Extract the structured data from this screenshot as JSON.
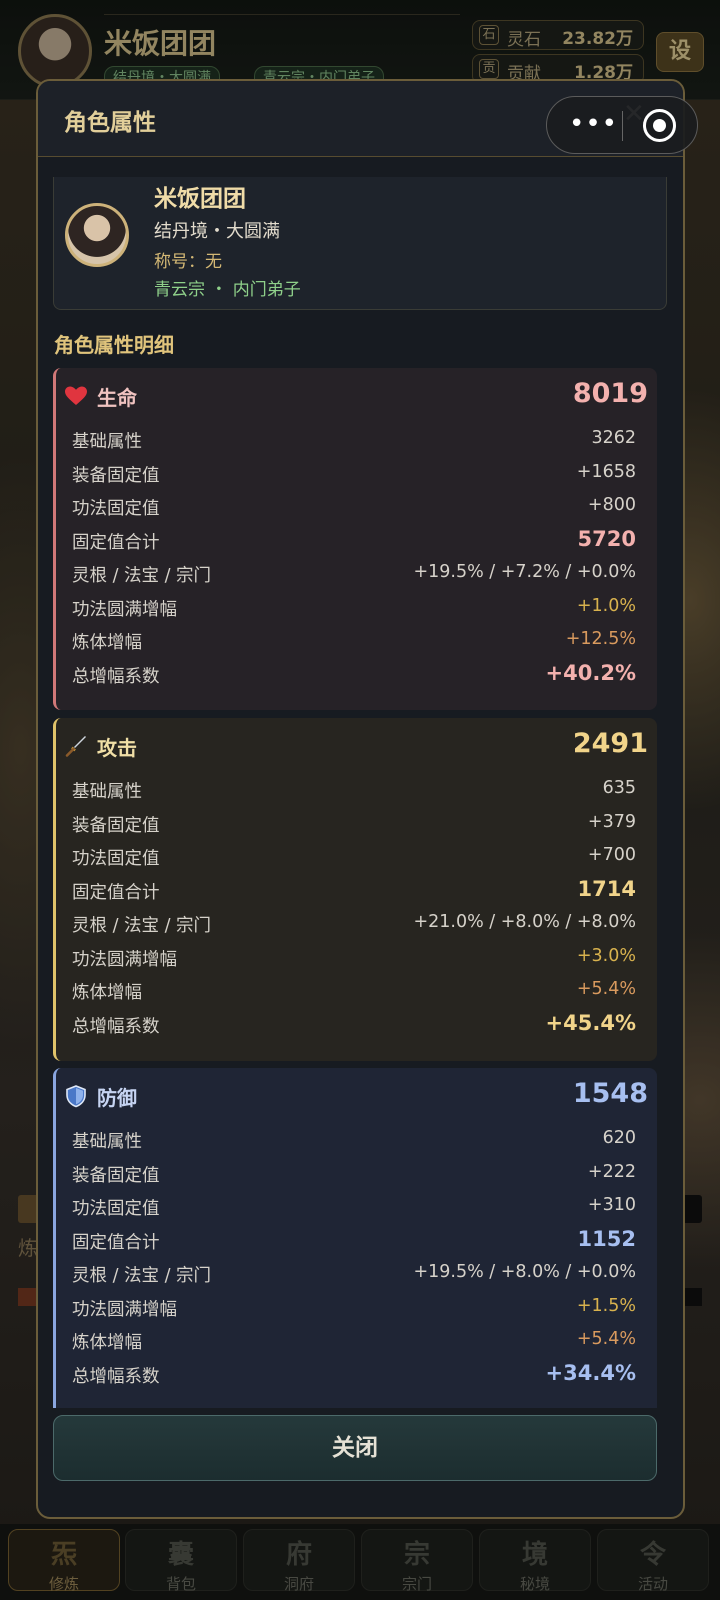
{
  "header": {
    "player_name": "米饭团团",
    "tag_realm": "结丹境・大圆满",
    "tag_sect": "青云宗・内门弟子",
    "resources": [
      {
        "icon_text": "石",
        "label": "灵石",
        "value": "23.82万"
      },
      {
        "icon_text": "贡",
        "label": "贡献",
        "value": "1.28万"
      }
    ],
    "settings_label": "设"
  },
  "background": {
    "left_text": "炼"
  },
  "modal": {
    "title": "角色属性",
    "profile": {
      "name": "米饭团团",
      "realm": "结丹境・大圆满",
      "title": "称号：无",
      "sect": "青云宗 ・ 内门弟子"
    },
    "section_title": "角色属性明细",
    "stats": {
      "hp": {
        "icon": "heart-icon",
        "name": "生命",
        "total": "8019",
        "rows": [
          {
            "label": "基础属性",
            "value": "3262"
          },
          {
            "label": "装备固定值",
            "value": "+1658"
          },
          {
            "label": "功法固定值",
            "value": "+800"
          },
          {
            "label": "固定值合计",
            "value": "5720"
          },
          {
            "label": "灵根 / 法宝 / 宗门",
            "value": "+19.5% / +7.2% / +0.0%"
          },
          {
            "label": "功法圆满增幅",
            "value": "+1.0%"
          },
          {
            "label": "炼体增幅",
            "value": "+12.5%"
          },
          {
            "label": "总增幅系数",
            "value": "+40.2%"
          }
        ]
      },
      "atk": {
        "icon": "sword-icon",
        "name": "攻击",
        "total": "2491",
        "rows": [
          {
            "label": "基础属性",
            "value": "635"
          },
          {
            "label": "装备固定值",
            "value": "+379"
          },
          {
            "label": "功法固定值",
            "value": "+700"
          },
          {
            "label": "固定值合计",
            "value": "1714"
          },
          {
            "label": "灵根 / 法宝 / 宗门",
            "value": "+21.0% / +8.0% / +8.0%"
          },
          {
            "label": "功法圆满增幅",
            "value": "+3.0%"
          },
          {
            "label": "炼体增幅",
            "value": "+5.4%"
          },
          {
            "label": "总增幅系数",
            "value": "+45.4%"
          }
        ]
      },
      "def": {
        "icon": "shield-icon",
        "name": "防御",
        "total": "1548",
        "rows": [
          {
            "label": "基础属性",
            "value": "620"
          },
          {
            "label": "装备固定值",
            "value": "+222"
          },
          {
            "label": "功法固定值",
            "value": "+310"
          },
          {
            "label": "固定值合计",
            "value": "1152"
          },
          {
            "label": "灵根 / 法宝 / 宗门",
            "value": "+19.5% / +8.0% / +0.0%"
          },
          {
            "label": "功法圆满增幅",
            "value": "+1.5%"
          },
          {
            "label": "炼体增幅",
            "value": "+5.4%"
          },
          {
            "label": "总增幅系数",
            "value": "+34.4%"
          }
        ]
      }
    },
    "close_label": "关闭",
    "close_x": "✕"
  },
  "capsule": {
    "dots": "•••"
  },
  "bottom_nav": [
    {
      "glyph": "炁",
      "label": "修炼",
      "active": true
    },
    {
      "glyph": "囊",
      "label": "背包",
      "active": false
    },
    {
      "glyph": "府",
      "label": "洞府",
      "active": false
    },
    {
      "glyph": "宗",
      "label": "宗门",
      "active": false
    },
    {
      "glyph": "境",
      "label": "秘境",
      "active": false
    },
    {
      "glyph": "令",
      "label": "活动",
      "active": false
    }
  ],
  "colors": {
    "accent_gold": "#e0c47c",
    "hp": "#f3b1ae",
    "atk": "#f1d48a",
    "def": "#a7bff0",
    "increase_gold": "#d8b24e",
    "body_increase_orange": "#d99a5e"
  }
}
